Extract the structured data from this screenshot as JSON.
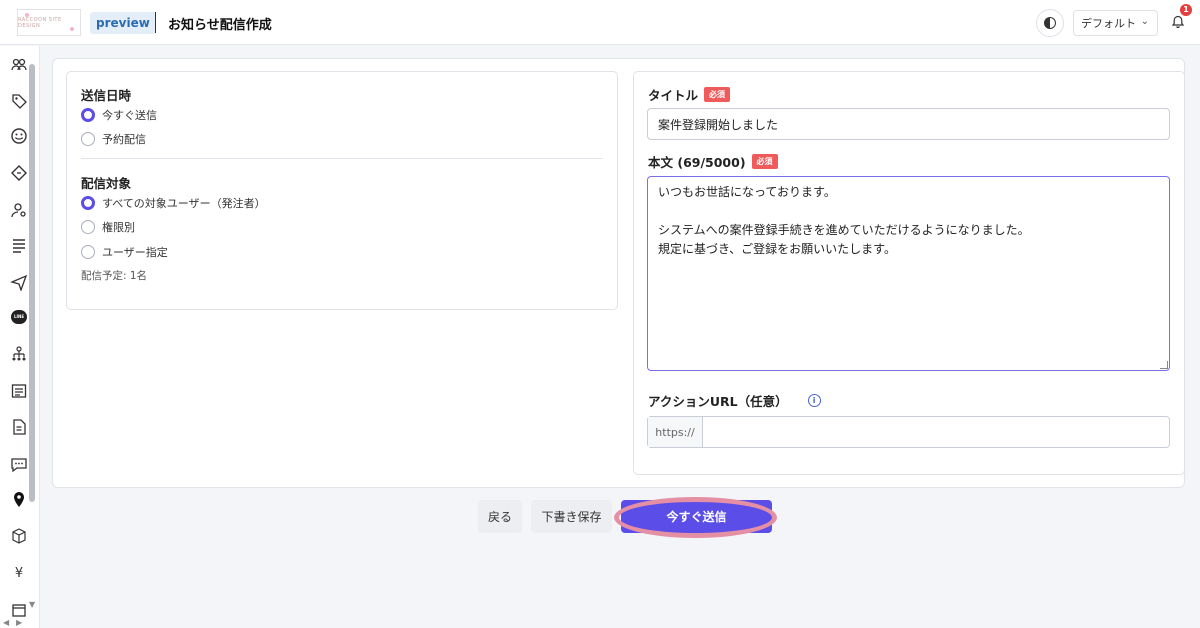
{
  "header": {
    "logo_text": "RACCOON SITE DESIGN",
    "env_label": "preview",
    "title": "お知らせ配信作成",
    "theme_select": "デフォルト",
    "notification_count": "1"
  },
  "sidebar": {
    "icons": [
      "group-icon",
      "tag-icon",
      "smile-icon",
      "coupon-icon",
      "user-settings-icon",
      "list-icon",
      "send-icon",
      "line-icon",
      "org-chart-icon",
      "article-icon",
      "document-icon",
      "chat-icon",
      "location-icon",
      "box-icon",
      "yen-icon",
      "calendar-icon"
    ],
    "yen_glyph": "¥",
    "line_glyph": "LINE"
  },
  "left": {
    "send_timing": {
      "title": "送信日時",
      "options": [
        {
          "label": "今すぐ送信",
          "checked": true
        },
        {
          "label": "予約配信",
          "checked": false
        }
      ]
    },
    "target": {
      "title": "配信対象",
      "options": [
        {
          "label": "すべての対象ユーザー（発注者）",
          "checked": true
        },
        {
          "label": "権限別",
          "checked": false
        },
        {
          "label": "ユーザー指定",
          "checked": false
        }
      ],
      "hint": "配信予定: 1名"
    }
  },
  "right": {
    "title_field": {
      "label": "タイトル",
      "required": "必須",
      "value": "案件登録開始しました"
    },
    "body_field": {
      "label": "本文 (69/5000)",
      "required": "必須",
      "value": "いつもお世話になっております。\n\nシステムへの案件登録手続きを進めていただけるようになりました。\n規定に基づき、ご登録をお願いいたします。"
    },
    "url_field": {
      "label": "アクションURL（任意）",
      "info_glyph": "i",
      "prefix": "https://",
      "value": ""
    }
  },
  "buttons": {
    "back": "戻る",
    "draft": "下書き保存",
    "send": "今すぐ送信"
  },
  "colors": {
    "accent": "#5b4ee8",
    "required": "#ef5b5b",
    "highlight": "#e58fa5"
  }
}
